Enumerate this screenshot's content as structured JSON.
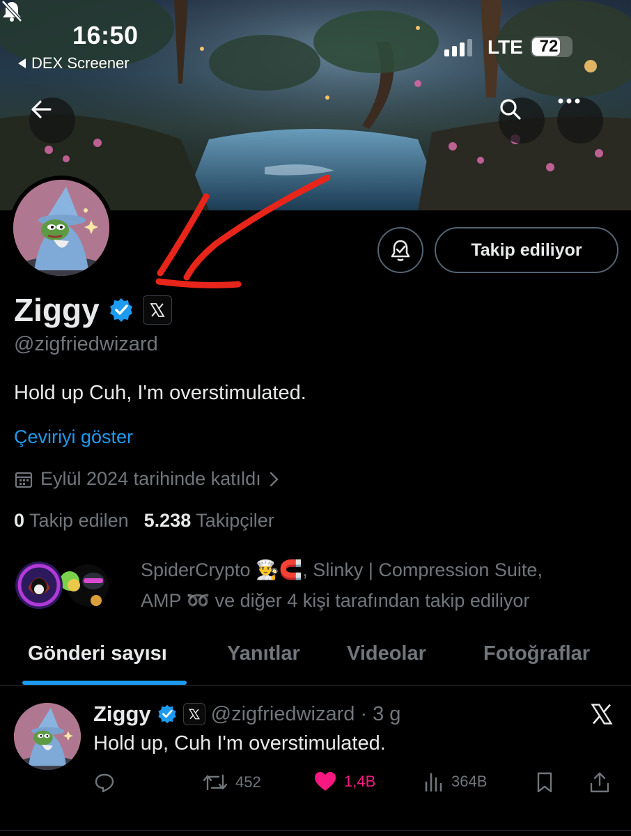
{
  "status_bar": {
    "time": "16:50",
    "back_app": "DEX Screener",
    "network": "LTE",
    "battery": "72",
    "battery_level": 0.72
  },
  "header": {
    "back_icon": "arrow-left-icon",
    "search_icon": "search-icon",
    "more_icon": "more-icon"
  },
  "profile": {
    "display_name": "Ziggy",
    "handle": "@zigfriedwizard",
    "bio": "Hold up Cuh, I'm overstimulated.",
    "translate_link": "Çeviriyi göster",
    "joined": "Eylül 2024 tarihinde katıldı",
    "following_count": "0",
    "following_label": "Takip edilen",
    "followers_count": "5.238",
    "followers_label": "Takipçiler",
    "follow_button": "Takip ediliyor",
    "followed_by_line1": "SpiderCrypto 👨‍🍳🧲, Slinky | Compression Suite,",
    "followed_by_line2": "AMP ➿ ve diğer 4 kişi tarafından takip ediliyor"
  },
  "tabs": [
    {
      "label": "Gönderi sayısı",
      "active": true
    },
    {
      "label": "Yanıtlar",
      "active": false
    },
    {
      "label": "Videolar",
      "active": false
    },
    {
      "label": "Fotoğraflar",
      "active": false
    }
  ],
  "post": {
    "name": "Ziggy",
    "handle": "@zigfriedwizard",
    "separator": "·",
    "age": "3 g",
    "text": "Hold up, Cuh I'm overstimulated.",
    "retweets": "452",
    "likes": "1,4B",
    "views": "364B"
  },
  "colors": {
    "background": "#000000",
    "accent": "#1d9bf0",
    "like": "#f91880",
    "secondary_text": "#71767b",
    "annotation_arrow": "#e8251a"
  }
}
